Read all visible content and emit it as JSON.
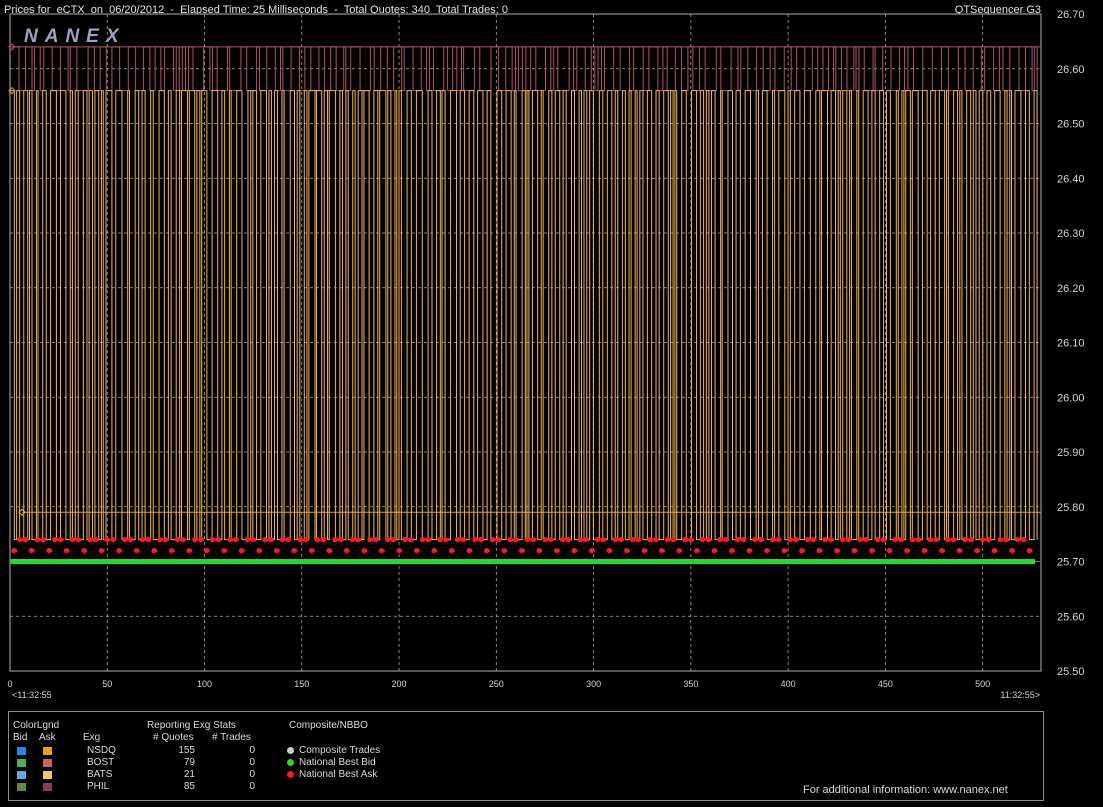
{
  "header": {
    "title": "Prices for  eCTX  on  06/20/2012  -  Elapsed Time: 25 Milliseconds  -  Total Quotes: 340  Total Trades: 0",
    "app_name": "QTSequencer G3",
    "logo_text": "NANEX"
  },
  "chart_data": {
    "type": "line",
    "x_axis": {
      "min": 0,
      "max": 530,
      "ticks": [
        0,
        50,
        100,
        150,
        200,
        250,
        300,
        350,
        400,
        450,
        500
      ],
      "start_label": "<11:32:55",
      "end_label": "11:32:55>"
    },
    "y_axis": {
      "min": 25.5,
      "max": 26.7,
      "ticks": [
        "25.50",
        "25.60",
        "25.70",
        "25.80",
        "25.90",
        "26.00",
        "26.10",
        "26.20",
        "26.30",
        "26.40",
        "26.50",
        "26.60",
        "26.70"
      ]
    },
    "grid": true,
    "series": [
      {
        "name": "National Best Bid",
        "color": "#22dd22",
        "flat_value": 25.7
      },
      {
        "name": "National Best Ask",
        "color": "#ff1a1a",
        "values": [
          25.72,
          25.74
        ]
      },
      {
        "name": "BATS Ask",
        "color": "#f0b45a",
        "values": [
          25.74,
          26.56
        ]
      },
      {
        "name": "PHIL Ask",
        "color": "#b0506a",
        "values": [
          26.56,
          26.64
        ]
      },
      {
        "name": "NSDQ Ask",
        "color": "#e89a2a",
        "flat_value": 25.79
      }
    ]
  },
  "legend": {
    "color_legend_title": "ColorLgnd",
    "bid_label": "Bid",
    "ask_label": "Ask",
    "exg_label": "Exg",
    "stats_title": "Reporting Exg Stats",
    "quotes_label": "# Quotes",
    "trades_label": "# Trades",
    "composite_title": "Composite/NBBO",
    "rows": [
      {
        "exg": "NSDQ",
        "quotes": "155",
        "trades": "0",
        "bid_color": "#1e88e5",
        "ask_color": "#f39c12"
      },
      {
        "exg": "BOST",
        "quotes": "79",
        "trades": "0",
        "bid_color": "#4caf50",
        "ask_color": "#c86464"
      },
      {
        "exg": "BATS",
        "quotes": "21",
        "trades": "0",
        "bid_color": "#5dade2",
        "ask_color": "#f5c26b"
      },
      {
        "exg": "PHIL",
        "quotes": "85",
        "trades": "0",
        "bid_color": "#5f8f3a",
        "ask_color": "#8e3a5e"
      }
    ],
    "composite": [
      {
        "label": "Composite Trades",
        "color": "#cccccc"
      },
      {
        "label": "National Best Bid",
        "color": "#22dd22"
      },
      {
        "label": "National Best Ask",
        "color": "#ff1a1a"
      }
    ],
    "footer": "For additional information: www.nanex.net"
  }
}
